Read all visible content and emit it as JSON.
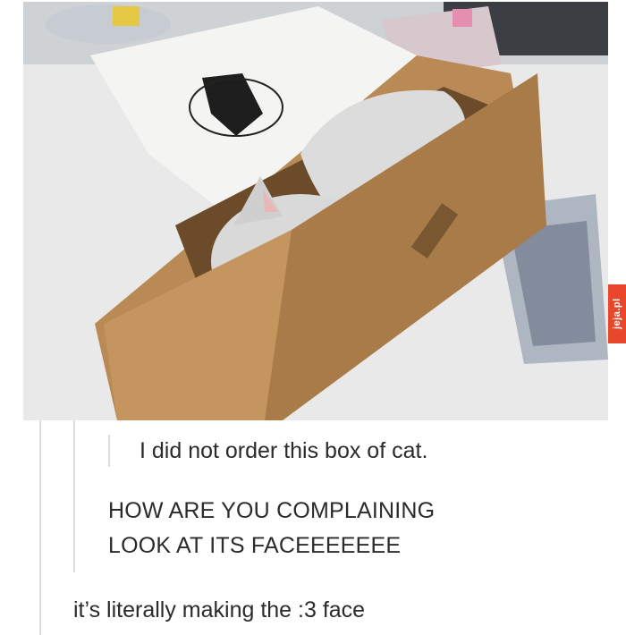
{
  "image": {
    "subject": "cat-in-box-photo",
    "watermark": "jeja.pl"
  },
  "thread": {
    "post_1": "I did not order this box of cat.",
    "reply_1_line_1": "HOW ARE YOU COMPLAINING",
    "reply_1_line_2": "LOOK AT ITS FACEEEEEEE",
    "reply_2": "it’s literally making the :3 face"
  },
  "colors": {
    "text": "#2b2b2b",
    "quote_line": "#dcdcdc",
    "watermark_bg": "#e9472b",
    "box": "#b98a55"
  }
}
